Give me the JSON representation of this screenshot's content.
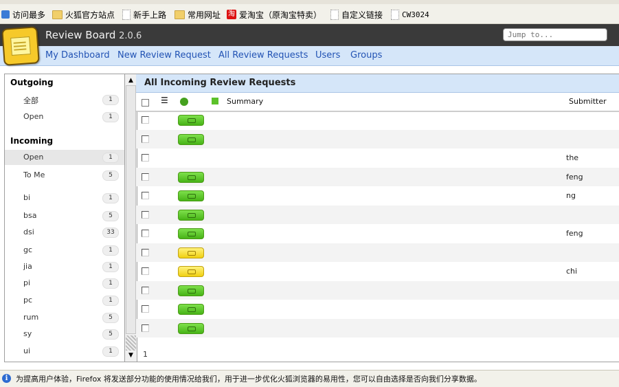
{
  "browser": {
    "bookmarks": [
      {
        "label": "访问最多",
        "icon": "star-icon"
      },
      {
        "label": "火狐官方站点",
        "icon": "folder-icon"
      },
      {
        "label": "新手上路",
        "icon": "page-icon"
      },
      {
        "label": "常用网址",
        "icon": "folder-icon"
      },
      {
        "label": "爱淘宝（原淘宝特卖）",
        "icon": "taobao-icon"
      },
      {
        "label": "自定义链接",
        "icon": "page-icon"
      },
      {
        "label": "CW3024",
        "icon": "page-icon"
      }
    ]
  },
  "header": {
    "title": "Review Board",
    "version": "2.0.6",
    "jump_placeholder": "Jump to..."
  },
  "nav": {
    "items": [
      "My Dashboard",
      "New Review Request",
      "All Review Requests",
      "Users",
      "Groups"
    ]
  },
  "sidebar": {
    "outgoing_heading": "Outgoing",
    "outgoing_items": [
      {
        "label": "全部",
        "count": "1"
      },
      {
        "label": "Open",
        "count": "1"
      }
    ],
    "incoming_heading": "Incoming",
    "incoming_items": [
      {
        "label": "Open",
        "count": "1",
        "selected": true
      },
      {
        "label": "To Me",
        "count": "5"
      },
      {
        "label": "bi",
        "count": "1"
      },
      {
        "label": "bsa",
        "count": "5"
      },
      {
        "label": "dsi",
        "count": "33"
      },
      {
        "label": "gc",
        "count": "1"
      },
      {
        "label": "jia",
        "count": "1"
      },
      {
        "label": "pi",
        "count": "1"
      },
      {
        "label": "pc",
        "count": "1"
      },
      {
        "label": "rum",
        "count": "5"
      },
      {
        "label": "sy",
        "count": "5"
      },
      {
        "label": "ui",
        "count": "1"
      }
    ]
  },
  "main": {
    "title": "All Incoming Review Requests",
    "columns": {
      "summary": "Summary",
      "submitter": "Submitter"
    },
    "rows": [
      {
        "ship": "green",
        "summary": "",
        "submitter": ""
      },
      {
        "ship": "green",
        "summary": "",
        "submitter": ""
      },
      {
        "ship": "none",
        "summary": "",
        "submitter": "the"
      },
      {
        "ship": "green",
        "summary": "",
        "submitter": "feng"
      },
      {
        "ship": "green",
        "summary": "",
        "submitter": "ng"
      },
      {
        "ship": "green",
        "summary": "",
        "submitter": ""
      },
      {
        "ship": "green",
        "summary": "",
        "submitter": "feng"
      },
      {
        "ship": "yellow",
        "summary": "",
        "submitter": ""
      },
      {
        "ship": "yellow",
        "summary": "",
        "submitter": "chi"
      },
      {
        "ship": "green",
        "summary": "",
        "submitter": ""
      },
      {
        "ship": "green",
        "summary": "",
        "submitter": ""
      },
      {
        "ship": "green",
        "summary": "",
        "submitter": ""
      }
    ],
    "pager": "1"
  },
  "statusbar": {
    "message": "为提高用户体验，Firefox 将发送部分功能的使用情况给我们，用于进一步优化火狐浏览器的易用性，您可以自由选择是否向我们分享数据。"
  },
  "colors": {
    "header_bg": "#3a3a3a",
    "nav_bg": "#d5e6f9",
    "link": "#2253b4",
    "ship_green": "#47b316",
    "ship_yellow": "#f0d012"
  }
}
